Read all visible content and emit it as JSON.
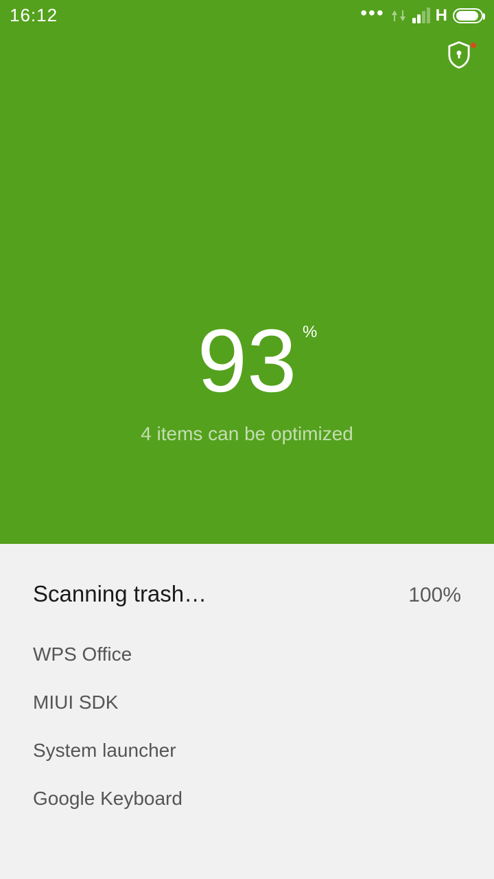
{
  "status": {
    "time": "16:12",
    "network_label": "H"
  },
  "score": {
    "value": "93",
    "unit": "%",
    "subtitle": "4 items can be optimized"
  },
  "scan": {
    "title": "Scanning trash…",
    "percent": "100%",
    "items": [
      "WPS Office",
      "MIUI SDK",
      "System launcher",
      "Google Keyboard"
    ]
  }
}
